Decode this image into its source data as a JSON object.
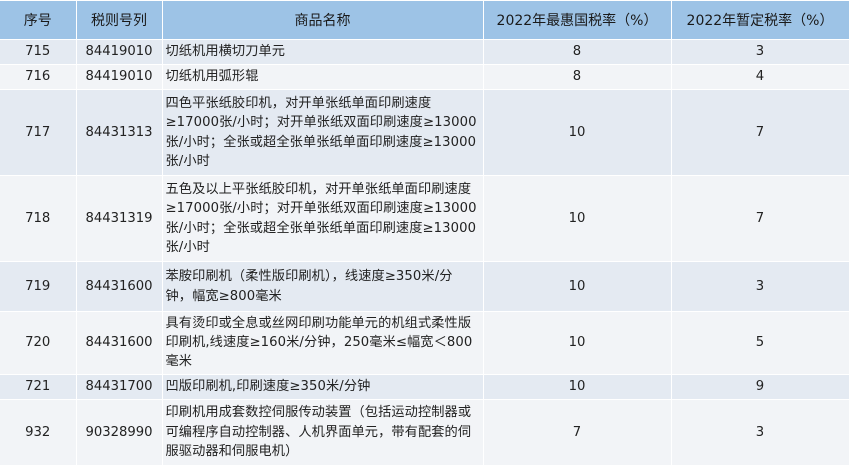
{
  "headers": [
    "序号",
    "税则号列",
    "商品名称",
    "2022年最惠国税率（%）",
    "2022年暂定税率（%）"
  ],
  "rows": [
    {
      "seq": "715",
      "code": "84419010",
      "name": "切纸机用横切刀单元",
      "mfn": "8",
      "provisional": "3"
    },
    {
      "seq": "716",
      "code": "84419010",
      "name": "切纸机用弧形辊",
      "mfn": "8",
      "provisional": "4"
    },
    {
      "seq": "717",
      "code": "84431313",
      "name": "四色平张纸胶印机，对开单张纸单面印刷速度≥17000张/小时；对开单张纸双面印刷速度≥13000张/小时；全张或超全张单张纸单面印刷速度≥13000张/小时",
      "mfn": "10",
      "provisional": "7"
    },
    {
      "seq": "718",
      "code": "84431319",
      "name": "五色及以上平张纸胶印机，对开单张纸单面印刷速度 ≥17000张/小时；对开单张纸双面印刷速度≥13000张/小时；全张或超全张单张纸单面印刷速度≥13000张/小时",
      "mfn": "10",
      "provisional": "7"
    },
    {
      "seq": "719",
      "code": "84431600",
      "name": "苯胺印刷机（柔性版印刷机），线速度≥350米/分钟，幅宽≥800毫米",
      "mfn": "10",
      "provisional": "3"
    },
    {
      "seq": "720",
      "code": "84431600",
      "name": "具有烫印或全息或丝网印刷功能单元的机组式柔性版印刷机,线速度≥160米/分钟，250毫米≤幅宽＜800毫米",
      "mfn": "10",
      "provisional": "5"
    },
    {
      "seq": "721",
      "code": "84431700",
      "name": "凹版印刷机,印刷速度≥350米/分钟",
      "mfn": "10",
      "provisional": "9"
    },
    {
      "seq": "932",
      "code": "90328990",
      "name": "印刷机用成套数控伺服传动装置（包括运动控制器或可编程序自动控制器、人机界面单元，带有配套的伺服驱动器和伺服电机）",
      "mfn": "7",
      "provisional": "3"
    }
  ]
}
